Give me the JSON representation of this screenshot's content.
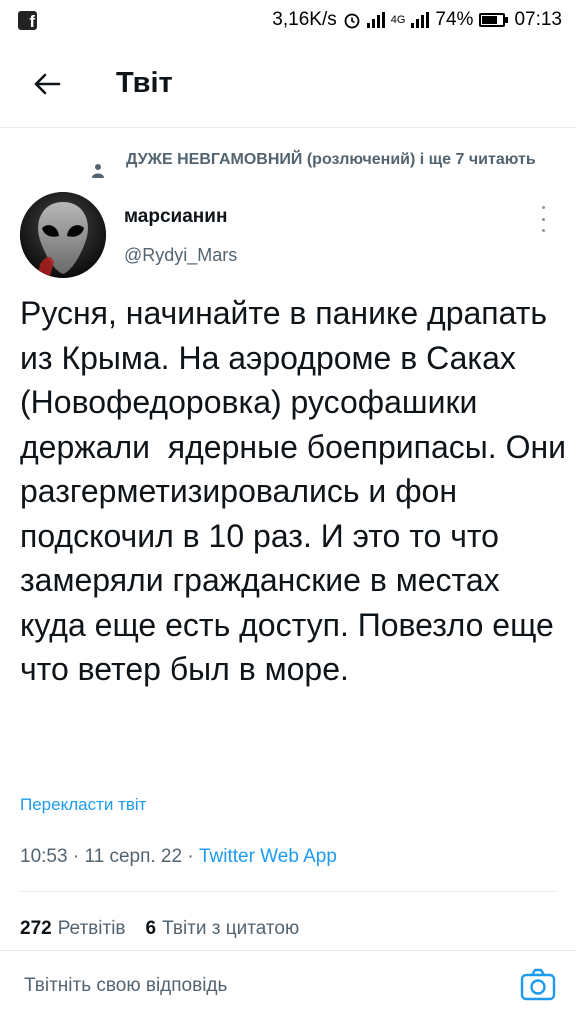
{
  "status_bar": {
    "net_speed": "3,16K/s",
    "network": "4G",
    "battery": "74%",
    "time": "07:13"
  },
  "header": {
    "title": "Твіт",
    "back_icon": "arrow-left-icon"
  },
  "tweet": {
    "social_context": "ДУЖЕ НЕВГАМОВНИЙ (розлючений) і ще 7 читають",
    "author_name": "марсианин",
    "author_handle": "@Rydyi_Mars",
    "text": "Русня, начинайте в панике драпать из Крыма. На аэродроме в Саках (Новофедоровка) русофашики держали  ядерные боеприпасы. Они разгерметизировались и фон подскочил в 10 раз. И это то что замеряли гражданские в местах куда еще есть доступ. Повезло еще что ветер был в море.",
    "translate_label": "Перекласти твіт",
    "time": "10:53",
    "date": "11 серп. 22",
    "source": "Twitter Web App",
    "separator": " · "
  },
  "stats": {
    "retweets_count": "272",
    "retweets_label": "Ретвітів",
    "quotes_count": "6",
    "quotes_label": "Твіти з цитатою"
  },
  "reply": {
    "placeholder": "Твітніть свою відповідь",
    "camera_icon": "camera-icon"
  },
  "colors": {
    "accent": "#1d9bf0",
    "secondary_text": "#536471",
    "border": "#e6ecf0"
  }
}
